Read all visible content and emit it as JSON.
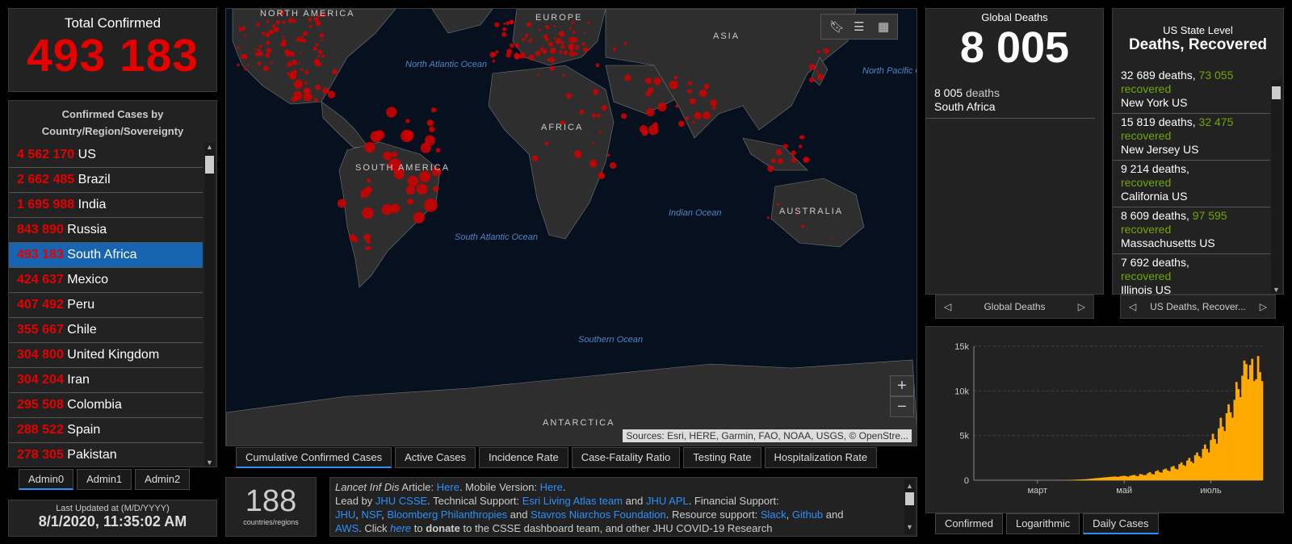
{
  "total": {
    "label": "Total Confirmed",
    "value": "493 183"
  },
  "country_panel": {
    "title": "Confirmed Cases by Country/Region/Sovereignty",
    "items": [
      {
        "value": "4 562 170",
        "name": "US"
      },
      {
        "value": "2 662 485",
        "name": "Brazil"
      },
      {
        "value": "1 695 988",
        "name": "India"
      },
      {
        "value": "843 890",
        "name": "Russia"
      },
      {
        "value": "493 183",
        "name": "South Africa",
        "selected": true
      },
      {
        "value": "424 637",
        "name": "Mexico"
      },
      {
        "value": "407 492",
        "name": "Peru"
      },
      {
        "value": "355 667",
        "name": "Chile"
      },
      {
        "value": "304 800",
        "name": "United Kingdom"
      },
      {
        "value": "304 204",
        "name": "Iran"
      },
      {
        "value": "295 508",
        "name": "Colombia"
      },
      {
        "value": "288 522",
        "name": "Spain"
      },
      {
        "value": "278 305",
        "name": "Pakistan"
      }
    ]
  },
  "admin_tabs": [
    "Admin0",
    "Admin1",
    "Admin2"
  ],
  "last_updated": {
    "label": "Last Updated at (M/D/YYYY)",
    "value": "8/1/2020, 11:35:02 AM"
  },
  "map": {
    "labels": {
      "north_america": "NORTH AMERICA",
      "europe": "EUROPE",
      "asia": "ASIA",
      "africa": "AFRICA",
      "south_america": "SOUTH AMERICA",
      "australia": "AUSTRALIA",
      "antarctica": "ANTARCTICA",
      "north_atlantic": "North Atlantic Ocean",
      "north_pacific": "North Pacific Ocean",
      "south_atlantic": "South Atlantic Ocean",
      "indian": "Indian Ocean",
      "southern": "Southern Ocean"
    },
    "attribution": "Sources: Esri, HERE, Garmin, FAO, NOAA, USGS, © OpenStre...",
    "zoom_in": "+",
    "zoom_out": "−"
  },
  "map_tabs": [
    "Cumulative Confirmed Cases",
    "Active Cases",
    "Incidence Rate",
    "Case-Fatality Ratio",
    "Testing Rate",
    "Hospitalization Rate"
  ],
  "countries": {
    "value": "188",
    "label": "countries/regions"
  },
  "info": {
    "l1_a": "Lancet Inf Dis",
    "l1_b": " Article: ",
    "l1_c": "Here",
    "l1_d": ". Mobile Version: ",
    "l1_e": "Here",
    "l1_f": ".",
    "l2_a": "Lead by ",
    "l2_b": "JHU CSSE",
    "l2_c": ". Technical Support: ",
    "l2_d": "Esri Living Atlas team",
    "l2_e": " and ",
    "l2_f": "JHU APL",
    "l2_g": ". Financial Support:",
    "l3_a": "JHU",
    "l3_b": ", ",
    "l3_c": "NSF",
    "l3_d": ", ",
    "l3_e": "Bloomberg Philanthropies",
    "l3_f": " and ",
    "l3_g": "Stavros Niarchos Foundation",
    "l3_h": ". Resource support: ",
    "l3_i": "Slack",
    "l3_j": ", ",
    "l3_k": "Github",
    "l3_l": " and",
    "l4_a": "AWS",
    "l4_b": ". Click ",
    "l4_c": "here",
    "l4_d": " to ",
    "l4_e": "donate",
    "l4_f": " to the CSSE dashboard team, and other JHU COVID-19 Research"
  },
  "global_deaths": {
    "label": "Global Deaths",
    "value": "8 005",
    "item": {
      "deaths": "8 005",
      "unit": "deaths",
      "name": "South Africa"
    },
    "pager_label": "Global Deaths"
  },
  "us_state": {
    "label": "US State Level",
    "title": "Deaths, Recovered",
    "items": [
      {
        "deaths": "32 689 deaths,",
        "recovered": "73 055",
        "rec_label": "recovered",
        "name": "New York US"
      },
      {
        "deaths": "15 819 deaths,",
        "recovered": "32 475",
        "rec_label": "recovered",
        "name": "New Jersey US"
      },
      {
        "deaths": "9 214 deaths,",
        "recovered": "",
        "rec_label": "recovered",
        "name": "California US"
      },
      {
        "deaths": "8 609 deaths,",
        "recovered": "97 595",
        "rec_label": "recovered",
        "name": "Massachusetts US"
      },
      {
        "deaths": "7 692 deaths,",
        "recovered": "",
        "rec_label": "recovered",
        "name": "Illinois US"
      }
    ],
    "pager_label": "US Deaths, Recover..."
  },
  "chart_tabs": [
    "Confirmed",
    "Logarithmic",
    "Daily Cases"
  ],
  "chart_data": {
    "type": "bar",
    "yticks": [
      "0",
      "5k",
      "10k",
      "15k"
    ],
    "ylim": [
      0,
      15000
    ],
    "xticks": [
      "март",
      "май",
      "июль"
    ],
    "color": "#ffaa00",
    "values": [
      0,
      0,
      0,
      0,
      0,
      0,
      0,
      0,
      0,
      0,
      0,
      0,
      0,
      0,
      0,
      0,
      0,
      0,
      0,
      0,
      0,
      0,
      0,
      0,
      0,
      0,
      0,
      0,
      0,
      0,
      0,
      0,
      0,
      0,
      0,
      0,
      0,
      0,
      0,
      0,
      0,
      0,
      0,
      2,
      5,
      10,
      15,
      20,
      30,
      40,
      50,
      60,
      70,
      80,
      90,
      100,
      110,
      130,
      150,
      180,
      200,
      220,
      240,
      260,
      280,
      300,
      320,
      340,
      360,
      380,
      400,
      420,
      400,
      380,
      450,
      480,
      500,
      450,
      400,
      500,
      550,
      600,
      500,
      450,
      700,
      650,
      550,
      600,
      800,
      900,
      700,
      650,
      1000,
      1100,
      900,
      850,
      1200,
      1300,
      1100,
      1000,
      1500,
      1600,
      1300,
      1200,
      1800,
      2000,
      1700,
      1600,
      2200,
      2500,
      2100,
      1900,
      2800,
      3100,
      2700,
      2500,
      3500,
      4000,
      3500,
      3100,
      4500,
      5200,
      4600,
      4100,
      5800,
      7000,
      6000,
      5500,
      7500,
      8500,
      7600,
      7000,
      9000,
      11000,
      10200,
      9300,
      11700,
      13400,
      13000,
      11300,
      12900,
      13600,
      11100,
      11300,
      13900,
      12100,
      11100
    ]
  }
}
